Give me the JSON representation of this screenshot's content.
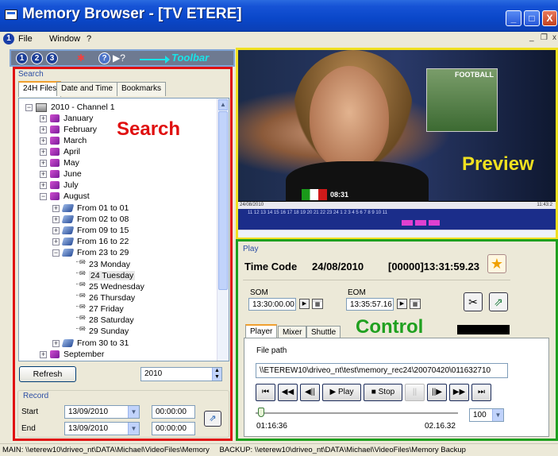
{
  "window": {
    "title": "Memory Browser - [TV ETERE]",
    "minimize": "_",
    "maximize": "□",
    "close": "X"
  },
  "menu": {
    "badge": "1",
    "file": "File",
    "window": "Window",
    "help": "?",
    "mdi_min": "_",
    "mdi_restore": "❐",
    "mdi_close": "x"
  },
  "toolbar": {
    "buttons": [
      "1",
      "2",
      "3"
    ],
    "label": "Toolbar"
  },
  "search": {
    "caption": "Search",
    "overlay": "Search",
    "tabs": [
      "24H Files",
      "Date and Time",
      "Bookmarks"
    ],
    "tree": {
      "root": "2010 - Channel 1",
      "months": [
        "January",
        "February",
        "March",
        "April",
        "May",
        "June",
        "July",
        "August"
      ],
      "weeks": [
        "From 01 to 01",
        "From 02 to 08",
        "From 09 to 15",
        "From 16 to 22",
        "From 23 to 29"
      ],
      "days": [
        "23 Monday",
        "24 Tuesday",
        "25 Wednesday",
        "26 Thursday",
        "27 Friday",
        "28 Saturday",
        "29 Sunday"
      ],
      "week_last": "From 30 to 31",
      "month_next": "September"
    },
    "refresh": "Refresh",
    "year": "2010"
  },
  "record": {
    "caption": "Record",
    "start_label": "Start",
    "end_label": "End",
    "start_date": "13/09/2010",
    "start_time": "00:00:00",
    "end_date": "13/09/2010",
    "end_time": "00:00:00"
  },
  "preview": {
    "overlay": "Preview",
    "inset_label": "FOOTBALL",
    "clock": "08:31",
    "timeline_date": "24/08/2010",
    "timeline_time": "11:43:2",
    "ticks": "11  12  13  14  15  16  17  18  19  20  21  22  23  24  1   2   3   4   5   6   7   8   9  10  11"
  },
  "control": {
    "caption": "Play",
    "timecode_label": "Time Code",
    "timecode_date": "24/08/2010",
    "timecode_value": "[00000]13:31:59.23",
    "som_label": "SOM",
    "som_value": "13:30:00.00",
    "eom_label": "EOM",
    "eom_value": "13:35:57.16",
    "overlay": "Control",
    "tabs": [
      "Player",
      "Mixer",
      "Shuttle"
    ],
    "file_path_label": "File path",
    "file_path": "\\\\ETEREW10\\driveo_nt\\test\\memory_rec24\\20070420\\011632710",
    "buttons": {
      "first": "⏮",
      "rewind": "◀◀",
      "step_back": "◀||",
      "play": "Play",
      "stop": "Stop",
      "pause": "||",
      "step_forward": "||▶",
      "forward": "▶▶",
      "last": "⏭"
    },
    "position": "01:16:36",
    "duration": "02.16.32",
    "speed": "100",
    "progress": 0.01
  },
  "status": {
    "main": "MAIN: \\\\eterew10\\driveo_nt\\DATA\\Michael\\VideoFiles\\Memory",
    "backup": "BACKUP: \\\\eterew10\\driveo_nt\\DATA\\Michael\\VideoFiles\\Memory Backup"
  },
  "colors": {
    "search_border": "#e01010",
    "preview_border": "#f0e020",
    "control_border": "#1fa01f",
    "toolbar_label": "#19e3e8"
  }
}
